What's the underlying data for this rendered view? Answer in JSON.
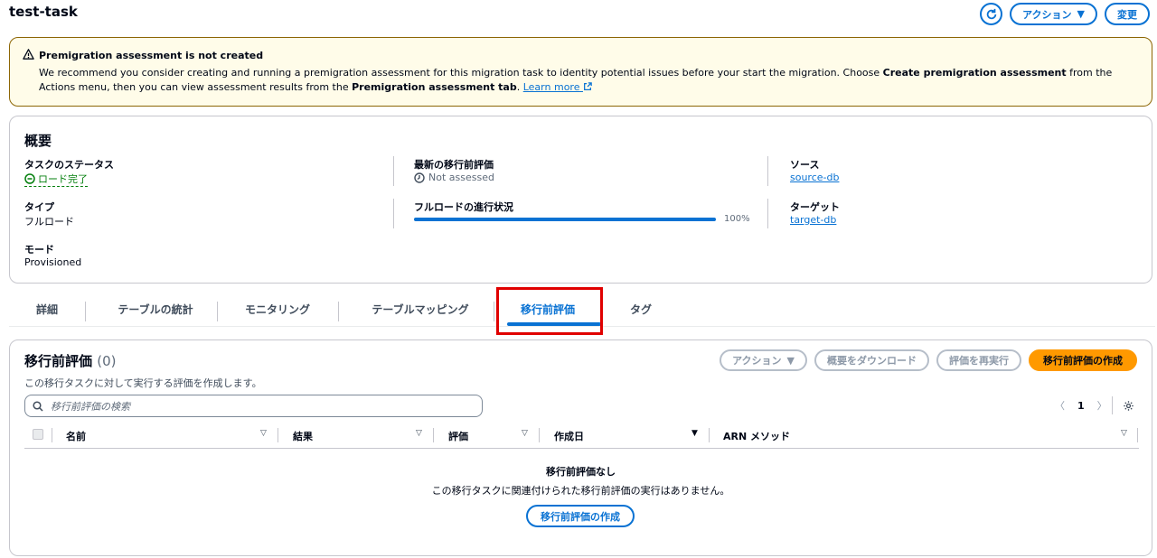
{
  "page": {
    "title": "test-task",
    "actions_label": "アクション",
    "modify_label": "変更"
  },
  "alert": {
    "title": "Premigration assessment is not created",
    "body_1": "We recommend you consider creating and running a premigration assessment for this migration task to identity potential issues before your start the migration. Choose ",
    "body_bold_1": "Create premigration assessment",
    "body_2": " from the Actions menu, then you can view assessment results from the ",
    "body_bold_2": "Premigration assessment tab",
    "body_3": ". ",
    "learn_more": "Learn more"
  },
  "overview": {
    "title": "概要",
    "task_status_label": "タスクのステータス",
    "task_status_value": "ロード完了",
    "type_label": "タイプ",
    "type_value": "フルロード",
    "mode_label": "モード",
    "mode_value": "Provisioned",
    "latest_assessment_label": "最新の移行前評価",
    "latest_assessment_value": "Not assessed",
    "full_load_progress_label": "フルロードの進行状況",
    "full_load_progress_text": "100%",
    "full_load_progress_fraction": 1.0,
    "source_label": "ソース",
    "source_value": "source-db",
    "target_label": "ターゲット",
    "target_value": "target-db"
  },
  "tabs": [
    {
      "label": "詳細"
    },
    {
      "label": "テーブルの統計"
    },
    {
      "label": "モニタリング"
    },
    {
      "label": "テーブルマッピング"
    },
    {
      "label": "移行前評価"
    },
    {
      "label": "タグ"
    }
  ],
  "assessments": {
    "title": "移行前評価",
    "count": "(0)",
    "description": "この移行タスクに対して実行する評価を作成します。",
    "actions_label": "アクション",
    "download_label": "概要をダウンロード",
    "rerun_label": "評価を再実行",
    "create_label": "移行前評価の作成",
    "search_placeholder": "移行前評価の検索",
    "page_number": "1",
    "columns": [
      "名前",
      "結果",
      "評価",
      "作成日",
      "ARN メソッド"
    ],
    "empty_title": "移行前評価なし",
    "empty_description": "この移行タスクに関連付けられた移行前評価の実行はありません。",
    "empty_create_label": "移行前評価の作成"
  },
  "colors": {
    "accent": "#0972d3",
    "primary_button": "#ff9900",
    "success": "#037f0c",
    "warning_border": "#8d6605",
    "highlight": "#e00000"
  }
}
